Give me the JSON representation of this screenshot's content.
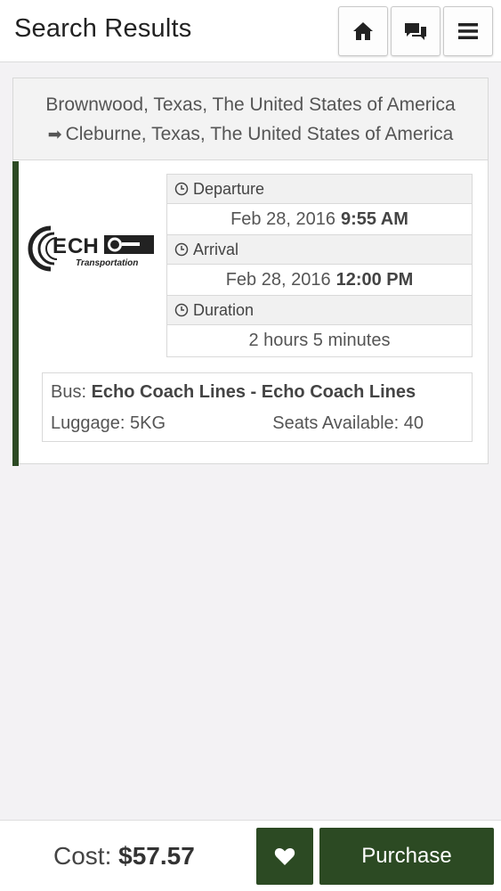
{
  "header": {
    "title": "Search Results",
    "buttons": [
      {
        "icon": "home-icon"
      },
      {
        "icon": "chat-icon"
      },
      {
        "icon": "menu-icon"
      }
    ]
  },
  "result": {
    "route": {
      "from": "Brownwood, Texas, The United States of America",
      "to": "Cleburne, Texas, The United States of America",
      "arrow_icon": "arrow-right-icon"
    },
    "operator_logo": {
      "brand_text": "ECHO",
      "sub_text": "Transportation"
    },
    "departure": {
      "label": "Departure",
      "date": "Feb 28, 2016",
      "time": "9:55 AM"
    },
    "arrival": {
      "label": "Arrival",
      "date": "Feb 28, 2016",
      "time": "12:00 PM"
    },
    "duration": {
      "label": "Duration",
      "value": "2 hours 5 minutes"
    },
    "bus": {
      "label": "Bus:",
      "name": "Echo Coach Lines - Echo Coach Lines"
    },
    "luggage": "Luggage: 5KG",
    "seats": "Seats Available: 40"
  },
  "footer": {
    "cost_label": "Cost:",
    "cost_value": "$57.57",
    "favorite_icon": "heart-icon",
    "purchase_label": "Purchase"
  },
  "colors": {
    "accent": "#2c4a23",
    "background": "#f3f2f4"
  }
}
